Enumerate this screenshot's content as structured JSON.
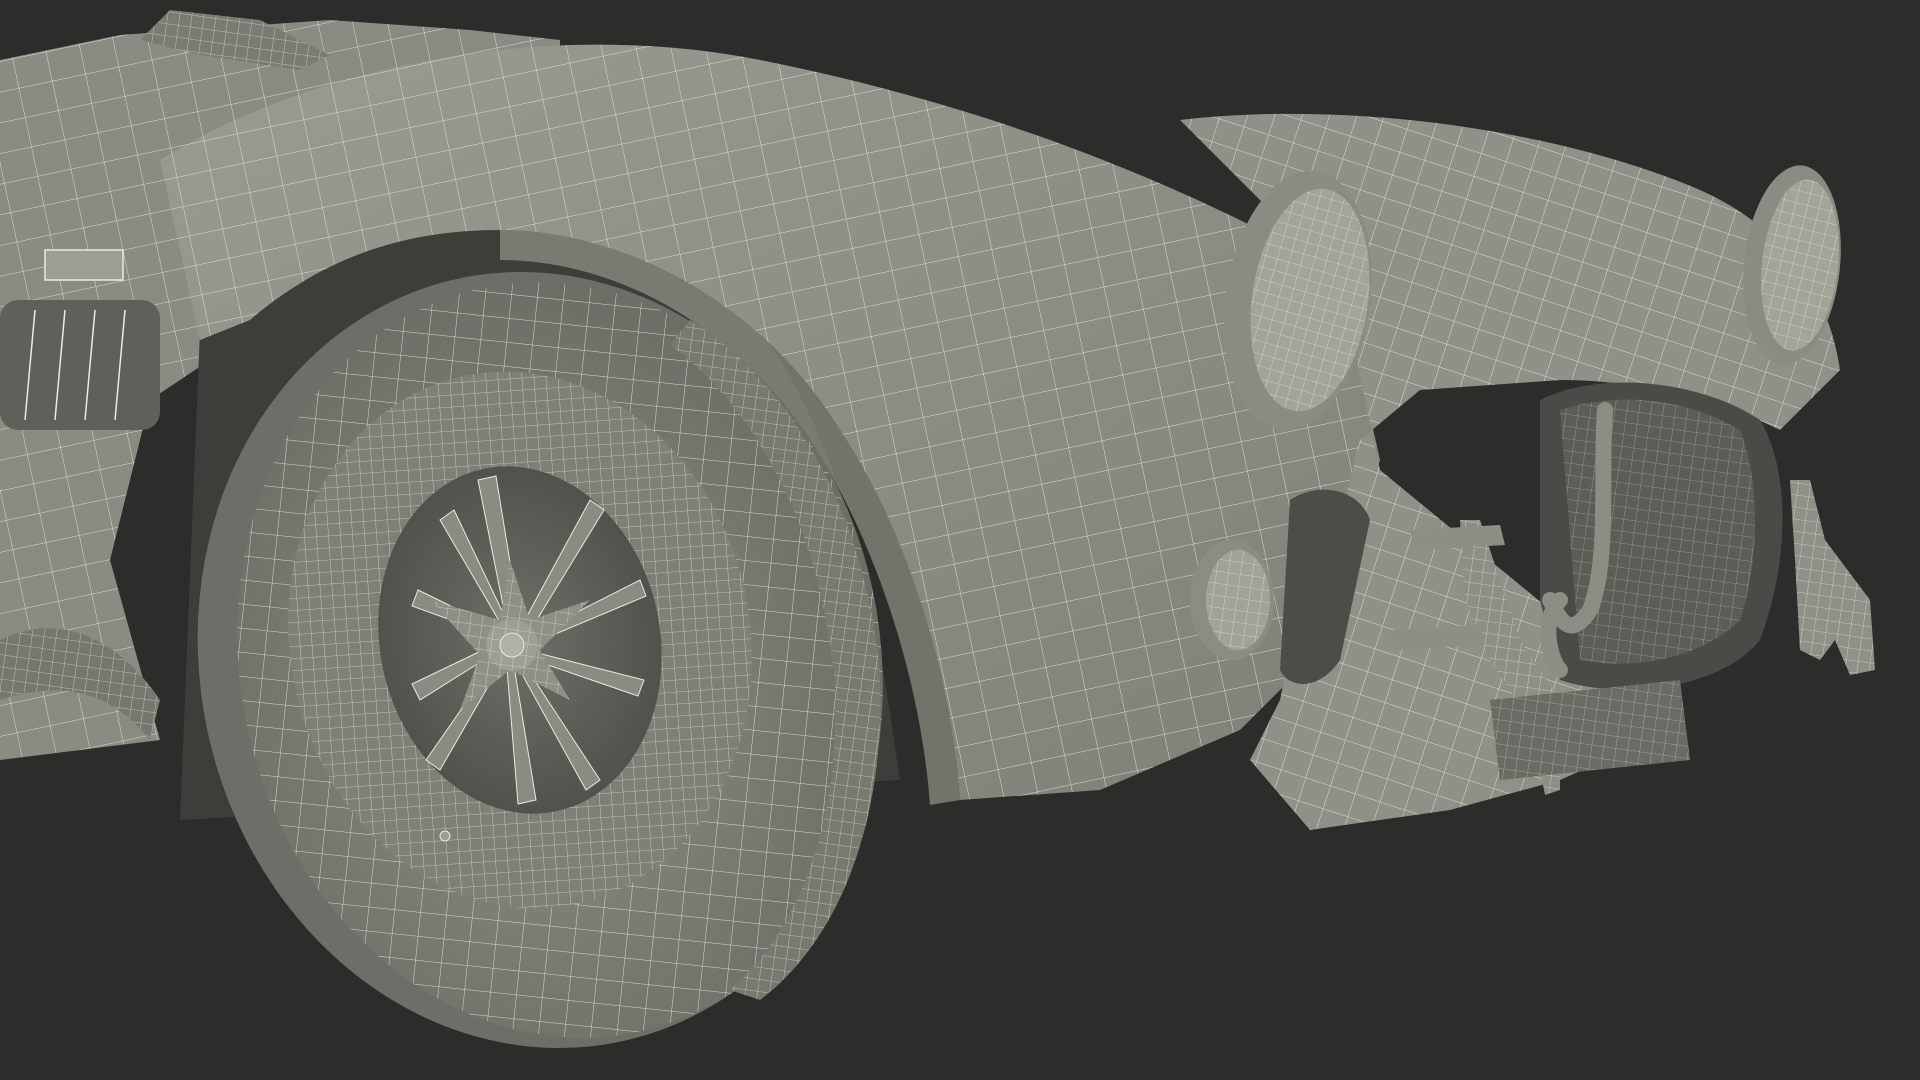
{
  "scene": {
    "subject": "wireframe-car-front",
    "colors": {
      "background": "#2c2c2a",
      "surface_light": "#93948a",
      "surface_mid": "#7e7f76",
      "surface_dark": "#5f605a",
      "shadow": "#3d3e3a",
      "wire": "#e9ebdf"
    }
  }
}
